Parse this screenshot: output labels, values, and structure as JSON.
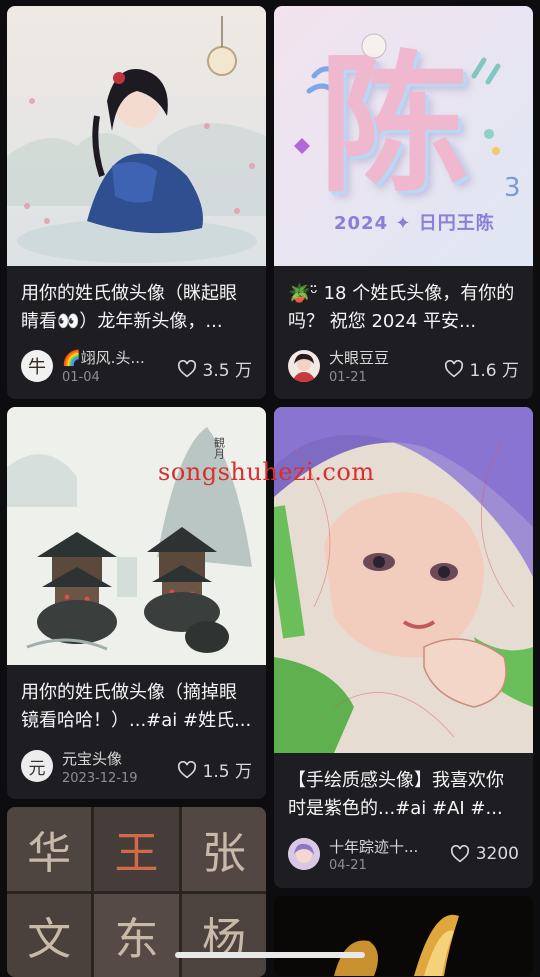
{
  "cards": [
    {
      "title": "用你的姓氏做头像（眯起眼睛看👀）龙年新头像，...",
      "author": "🌈翊风.头...",
      "date": "01-04",
      "likes": "3.5 万",
      "avatar_char": "牛"
    },
    {
      "title": "🪴ᵕ̈ 18 个姓氏头像，有你的吗？ 祝您 2024 平安...",
      "author": "大眼豆豆",
      "date": "01-21",
      "likes": "1.6 万",
      "image_text": "陈",
      "image_caption": "2024 ✦ 日円王陈"
    },
    {
      "title": "用你的姓氏做头像（摘掉眼镜看哈哈！）...#ai #姓氏...",
      "author": "元宝头像",
      "date": "2023-12-19",
      "likes": "1.5 万",
      "avatar_char": "元"
    },
    {
      "title": "【手绘质感头像】我喜欢你时是紫色的...#ai #AI #...",
      "author": "十年踪迹十...",
      "date": "04-21",
      "likes": "3200"
    },
    {
      "image_chars": [
        "华",
        "王",
        "张",
        "文",
        "东",
        "杨"
      ]
    }
  ],
  "watermark": "songshuhezi.com",
  "colors": {
    "background": "#0d0d0f",
    "card": "#1e1e22",
    "watermark": "#d82f2f"
  }
}
